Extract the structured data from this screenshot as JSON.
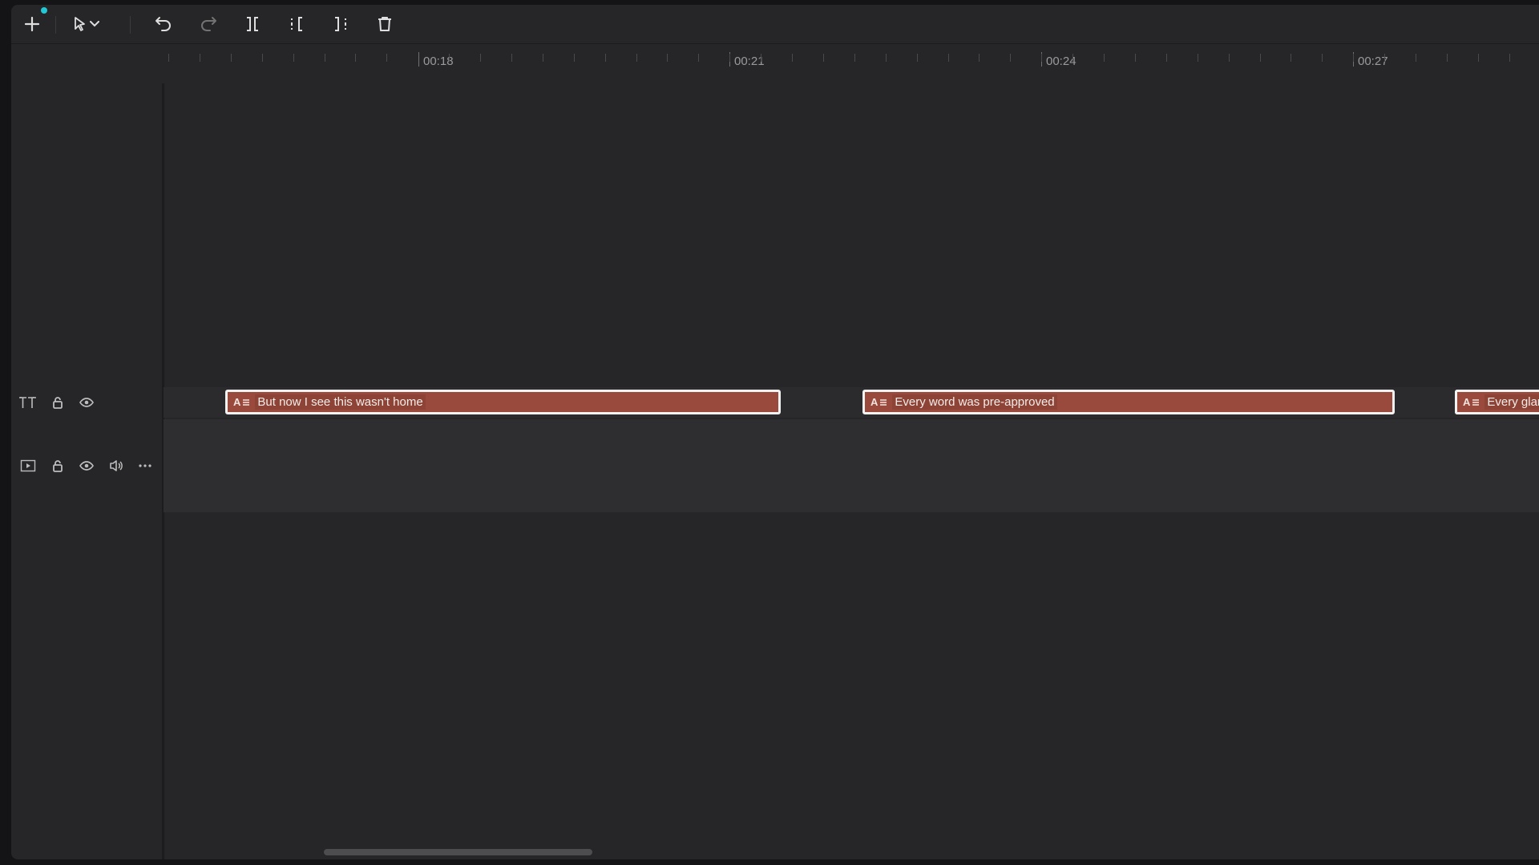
{
  "toolbar": {
    "icons": [
      "plus-icon",
      "pointer-icon",
      "chevron-down-icon",
      "undo-icon",
      "redo-icon",
      "split-icon",
      "trim-left-icon",
      "trim-right-icon",
      "trash-icon"
    ]
  },
  "ruler": {
    "labels": [
      "00:18",
      "00:21",
      "00:24",
      "00:27"
    ]
  },
  "tracks": {
    "text": {
      "icon": "text-track-icon"
    },
    "video": {
      "icon": "video-track-icon"
    }
  },
  "clips": [
    {
      "badge": "A",
      "text": "But now I see this wasn't home"
    },
    {
      "badge": "A",
      "text": "Every word was pre-approved"
    },
    {
      "badge": "A",
      "text": "Every glar"
    }
  ],
  "colors": {
    "clip_bg": "#9a4a3c",
    "accent_dot": "#22c8d6",
    "panel_bg": "#262628"
  }
}
